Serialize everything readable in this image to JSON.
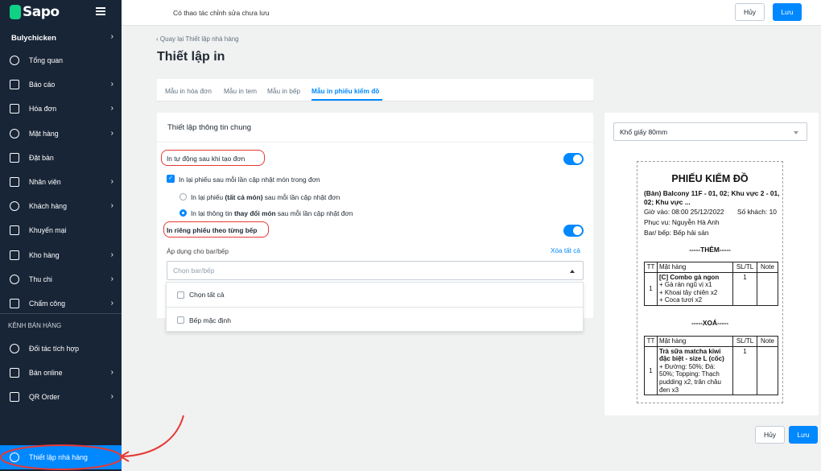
{
  "brand": {
    "name": "Sapo"
  },
  "topbar": {
    "unsaved_text": "Có thao tác chỉnh sửa chưa lưu",
    "cancel_label": "Hủy",
    "save_label": "Lưu"
  },
  "sidebar": {
    "store_name": "Bulychicken",
    "items": [
      {
        "label": "Tổng quan",
        "icon": "home-icon",
        "chevron": false
      },
      {
        "label": "Báo cáo",
        "icon": "chart-icon",
        "chevron": true
      },
      {
        "label": "Hóa đơn",
        "icon": "invoice-icon",
        "chevron": true
      },
      {
        "label": "Mặt hàng",
        "icon": "dish-icon",
        "chevron": true
      },
      {
        "label": "Đặt bàn",
        "icon": "calendar-icon",
        "chevron": false
      },
      {
        "label": "Nhân viên",
        "icon": "users-icon",
        "chevron": true
      },
      {
        "label": "Khách hàng",
        "icon": "user-icon",
        "chevron": true
      },
      {
        "label": "Khuyến mại",
        "icon": "gear-badge-icon",
        "chevron": false
      },
      {
        "label": "Kho hàng",
        "icon": "warehouse-icon",
        "chevron": true
      },
      {
        "label": "Thu chi",
        "icon": "cashbook-icon",
        "chevron": true
      },
      {
        "label": "Chấm công",
        "icon": "fingerprint-icon",
        "chevron": true
      }
    ],
    "section_title": "KÊNH BÁN HÀNG",
    "channels": [
      {
        "label": "Đối tác tích hợp",
        "icon": "partner-icon",
        "chevron": false
      },
      {
        "label": "Bán online",
        "icon": "globe-icon",
        "chevron": true
      },
      {
        "label": "QR Order",
        "icon": "qr-icon",
        "chevron": true
      }
    ],
    "active_item": {
      "label": "Thiết lập nhà hàng",
      "icon": "gear-icon"
    }
  },
  "page": {
    "back_link": "Quay lại Thiết lập nhà hàng",
    "title": "Thiết lập in"
  },
  "tabs": [
    {
      "label": "Mẫu in hóa đơn",
      "active": false
    },
    {
      "label": "Mẫu in tem",
      "active": false
    },
    {
      "label": "Mẫu in bếp",
      "active": false
    },
    {
      "label": "Mẫu in phiếu kiểm đồ",
      "active": true
    }
  ],
  "settings": {
    "card_title": "Thiết lập thông tin chung",
    "auto_print_label": "In tự động sau khi tạo đơn",
    "auto_print_on": true,
    "reprint_checkbox_label": "In lại phiếu sau mỗi lần cập nhật món trong đơn",
    "reprint_checked": true,
    "radio_all": {
      "prefix": "In lại phiếu ",
      "bold": "(tất cả món)",
      "suffix": " sau mỗi lần cập nhật đơn",
      "selected": false
    },
    "radio_changes": {
      "prefix": "In lại thông tin ",
      "bold": "thay đổi món",
      "suffix": " sau mỗi lần cập nhật đơn",
      "selected": true
    },
    "separate_kitchen_label": "In riêng phiếu theo từng bếp",
    "separate_kitchen_on": true,
    "apply_label": "Áp dụng cho bar/bếp",
    "clear_all_label": "Xóa tất cả",
    "kitchen_select_placeholder": "Chọn bar/bếp",
    "dropdown_options": [
      "Chọn tất cả",
      "Bếp mặc định"
    ]
  },
  "preview": {
    "paper_size": "Khổ giấy 80mm",
    "receipt": {
      "title": "PHIẾU KIỂM ĐỒ",
      "table_line": "(Bàn) Balcony 11F - 01, 02; Khu vực 2 - 01, 02; Khu vực ...",
      "checkin": "Giờ vào: 08:00 25/12/2022",
      "guests": "Số khách: 10",
      "server": "Phục vụ: Nguyễn Hà Anh",
      "bar": "Bar/ bếp: Bếp hải sản",
      "added_title": "-----THÊM-----",
      "removed_title": "-----XOÁ-----",
      "headers": [
        "TT",
        "Mặt hàng",
        "SL/TL",
        "Note"
      ],
      "added_rows": [
        {
          "no": "1",
          "name": "[C] Combo gà ngon",
          "details": [
            "+ Gà rán ngũ vị x1",
            "+ Khoai tây chiên x2",
            "+ Coca tươi x2"
          ],
          "qty": "1",
          "note": ""
        }
      ],
      "removed_rows": [
        {
          "no": "1",
          "name": "Trà sữa matcha kiwi đặc biệt - size L (cốc)",
          "details": [
            "+ Đường: 50%; Đá: 50%; Topping: Thạch pudding x2, trân châu đen x3"
          ],
          "qty": "1",
          "note": ""
        }
      ]
    }
  },
  "footer": {
    "cancel_label": "Hủy",
    "save_label": "Lưu"
  }
}
